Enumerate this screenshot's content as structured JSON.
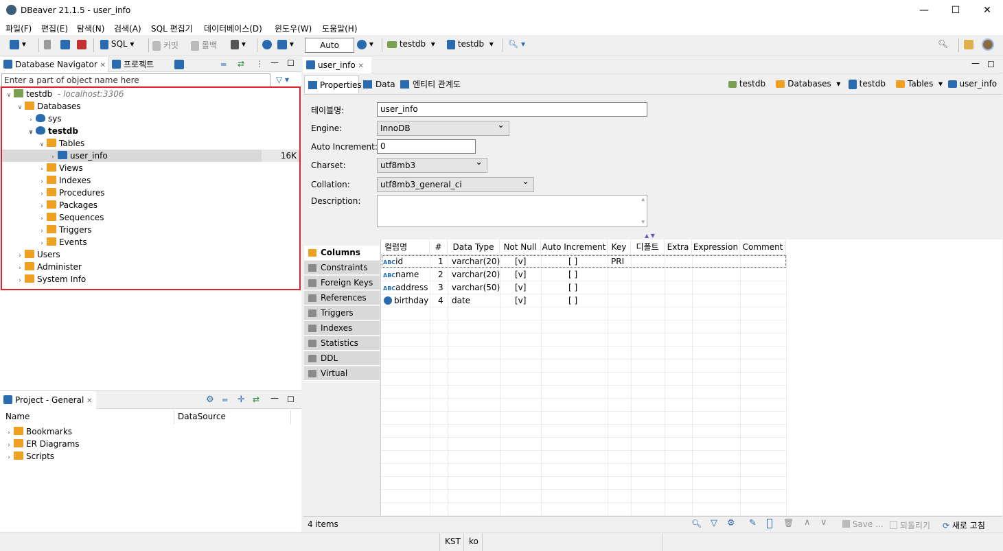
{
  "window": {
    "title": "DBeaver 21.1.5 - user_info",
    "minimize": "—",
    "maximize": "☐",
    "close": "✕"
  },
  "menu": [
    "파일(F)",
    "편집(E)",
    "탐색(N)",
    "검색(A)",
    "SQL 편집기",
    "데이터베이스(D)",
    "윈도우(W)",
    "도움말(H)"
  ],
  "toolbar": {
    "sql": "SQL",
    "commit": "커밋",
    "rollback": "롤백",
    "txn_mode": "Auto",
    "conn1": "testdb",
    "conn2": "testdb"
  },
  "navigator": {
    "tab1": "Database Navigator",
    "tab2": "프로젝트",
    "filter_placeholder": "Enter a part of object name here",
    "connection": "testdb",
    "host": "- localhost:3306",
    "databases": "Databases",
    "sys": "sys",
    "testdb": "testdb",
    "tables": "Tables",
    "user_info": "user_info",
    "user_info_size": "16K",
    "views": "Views",
    "indexes": "Indexes",
    "procedures": "Procedures",
    "packages": "Packages",
    "sequences": "Sequences",
    "triggers": "Triggers",
    "events": "Events",
    "users": "Users",
    "administer": "Administer",
    "system_info": "System Info"
  },
  "project": {
    "tab": "Project - General",
    "col_name": "Name",
    "col_ds": "DataSource",
    "items": [
      "Bookmarks",
      "ER Diagrams",
      "Scripts"
    ]
  },
  "editor": {
    "tab": "user_info",
    "subtabs": [
      "Properties",
      "Data",
      "엔티티 관계도"
    ],
    "breadcrumb": [
      "testdb",
      "Databases",
      "testdb",
      "Tables",
      "user_info"
    ],
    "labels": {
      "table_name": "테이블명:",
      "engine": "Engine:",
      "auto_inc": "Auto Increment:",
      "charset": "Charset:",
      "collation": "Collation:",
      "description": "Description:"
    },
    "values": {
      "table_name": "user_info",
      "engine": "InnoDB",
      "auto_inc": "0",
      "charset": "utf8mb3",
      "collation": "utf8mb3_general_ci"
    },
    "side_tabs": [
      "Columns",
      "Constraints",
      "Foreign Keys",
      "References",
      "Triggers",
      "Indexes",
      "Statistics",
      "DDL",
      "Virtual"
    ],
    "columns_header": [
      "컬럼명",
      "#",
      "Data Type",
      "Not Null",
      "Auto Increment",
      "Key",
      "디폴트",
      "Extra",
      "Expression",
      "Comment"
    ],
    "rows": [
      {
        "name": "id",
        "num": "1",
        "type": "varchar(20)",
        "notnull": "[v]",
        "autoinc": "[ ]",
        "key": "PRI"
      },
      {
        "name": "name",
        "num": "2",
        "type": "varchar(20)",
        "notnull": "[v]",
        "autoinc": "[ ]",
        "key": ""
      },
      {
        "name": "address",
        "num": "3",
        "type": "varchar(50)",
        "notnull": "[v]",
        "autoinc": "[ ]",
        "key": ""
      },
      {
        "name": "birthday",
        "num": "4",
        "type": "date",
        "notnull": "[v]",
        "autoinc": "[ ]",
        "key": ""
      }
    ],
    "items_count": "4 items",
    "save": "Save ...",
    "revert": "되돌리기",
    "refresh": "새로 고침"
  },
  "status": {
    "tz": "KST",
    "locale": "ko"
  },
  "colors": {
    "accent": "#2a6bb0",
    "folder": "#f0a020",
    "highlight": "#e0202a"
  }
}
